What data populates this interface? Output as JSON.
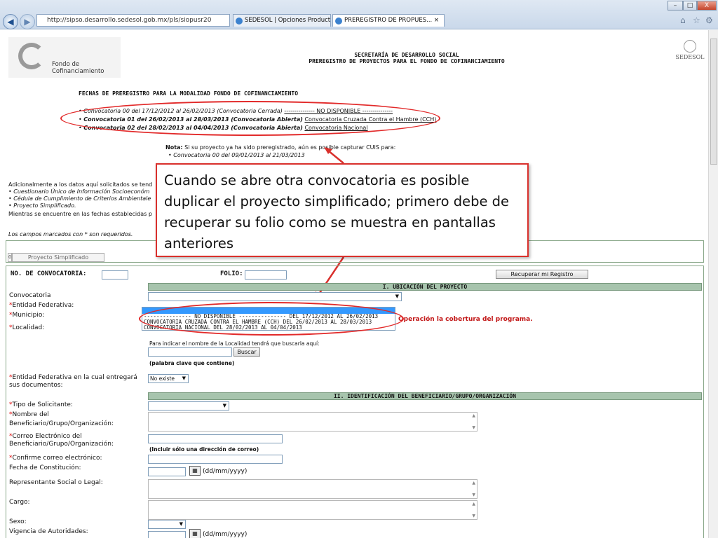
{
  "browser": {
    "address": "http://sipso.desarrollo.sedesol.gob.mx/pls/siopusr20",
    "tabs": [
      {
        "label": "SEDESOL | Opciones Productivas"
      },
      {
        "label": "PREREGISTRO DE PROPUES... ×"
      }
    ],
    "window_buttons": [
      "–",
      "□",
      "X"
    ],
    "tool_icons": [
      "⌂",
      "☆",
      "⚙"
    ]
  },
  "header": {
    "logo_text_1": "Fondo de",
    "logo_text_2": "Cofinanciamiento",
    "title_1": "SECRETARÍA DE DESARROLLO SOCIAL",
    "title_2": "PREREGISTRO DE PROYECTOS PARA EL FONDO DE COFINANCIAMIENTO",
    "brand": "SEDESOL"
  },
  "fechas": {
    "title": "FECHAS DE PREREGISTRO PARA LA MODALIDAD FONDO DE COFINANCIAMIENTO",
    "items": [
      {
        "text": "Convocatoria 00 del 17/12/2012 al 26/02/2013 (Convocatoria Cerrada)",
        "link": "--------------- NO DISPONIBLE ---------------"
      },
      {
        "text": "Convocatoria 01 del 26/02/2013 al 28/03/2013 (Convocatoria Abierta)",
        "link": "Convocatoria Cruzada Contra el Hambre (CCH)"
      },
      {
        "text": "Convocatoria 02 del 28/02/2013 al 04/04/2013 (Convocatoria Abierta)",
        "link": "Convocatoria Nacional"
      }
    ]
  },
  "nota": {
    "label": "Nota:",
    "text": "Si su proyecto ya ha sido preregistrado, aún es posible capturar CUIS para:",
    "items": [
      "Convocatoria 00 del 09/01/2013 al 21/03/2013"
    ]
  },
  "side": {
    "intro": "Adicionalmente a los datos aquí solicitados se tend",
    "items": [
      "Cuestionario Único de Información Socioeconóm",
      "Cédula de Cumplimiento de Criterios Ambientale",
      "Proyecto Simplificado."
    ],
    "footer": "Mientras se encuentre en las fechas establecidas p",
    "required_note": "Los campos marcados con * son requeridos."
  },
  "callout": {
    "text": "Cuando se abre otra convocatoria es posible duplicar el proyecto simplificado; primero debe de recuperar su folio como se muestra en pantallas anteriores"
  },
  "proyecto": {
    "counter": "0",
    "button": "Proyecto Simplificado"
  },
  "form": {
    "no_convocatoria_label": "NO. DE CONVOCATORIA:",
    "folio_label": "FOLIO:",
    "recuperar_button": "Recuperar mi Registro",
    "section_1": "I. UBICACIÓN DEL PROYECTO",
    "convocatoria_label": "Convocatoria",
    "entidad_label": "Entidad Federativa:",
    "municipio_label": "Municipio:",
    "localidad_label": "Localidad:",
    "dropdown_options": [
      "--------------- NO DISPONIBLE --------------- DEL 17/12/2012 AL 26/02/2013",
      "CONVOCATORIA CRUZADA CONTRA EL HAMBRE (CCH) DEL 26/02/2013 AL 28/03/2013",
      "CONVOCATORIA NACIONAL DEL 28/02/2013 AL 04/04/2013"
    ],
    "warning": "Operación la cobertura del programa.",
    "localidad_hint": "Para indicar el nombre de la Localidad tendrá que buscarla aquí:",
    "buscar_button": "Buscar",
    "palabra_clave": "(palabra clave que contiene)",
    "entidad_entrega_label_1": "Entidad Federativa en la cual entregará",
    "entidad_entrega_label_2": "sus documentos:",
    "no_existe": "No existe",
    "section_2": "II. IDENTIFICACIÓN DEL BENEFICIARIO/GRUPO/ORGANIZACIÓN",
    "tipo_solicitante": "Tipo de Solicitante:",
    "nombre_del": "Nombre del",
    "beneficiario_1": "Beneficiario/Grupo/Organización:",
    "correo_1": "Correo Electrónico del",
    "beneficiario_2": "Beneficiario/Grupo/Organización:",
    "incluir_correo": "(Incluir sólo una dirección de correo)",
    "confirme_correo": "Confirme correo electrónico:",
    "fecha_constitucion": "Fecha de Constitución:",
    "date_format": "(dd/mm/yyyy)",
    "representante": "Representante Social o Legal:",
    "cargo": "Cargo:",
    "sexo": "Sexo:",
    "vigencia": "Vigencia de Autoridades:",
    "asterisk": "*"
  }
}
